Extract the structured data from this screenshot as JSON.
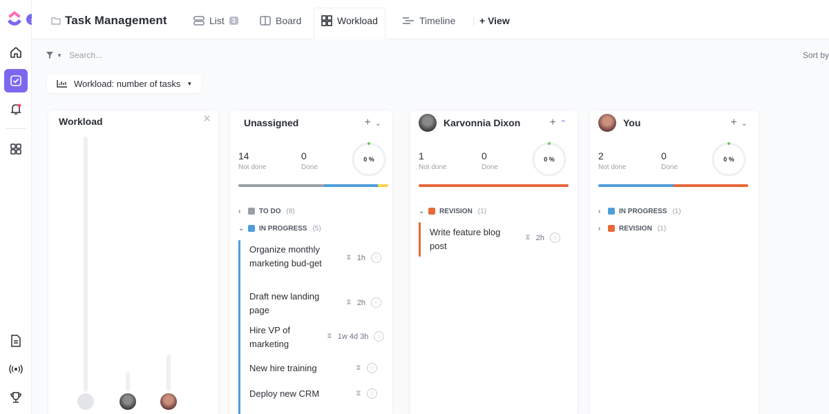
{
  "app": {
    "project_title": "Task Management",
    "views": [
      {
        "label": "List",
        "badge": "3"
      },
      {
        "label": "Board"
      },
      {
        "label": "Workload"
      },
      {
        "label": "Timeline"
      }
    ],
    "add_view_label": "+ View",
    "active_view": "Workload"
  },
  "toolbar": {
    "search_placeholder": "Search...",
    "sort_label": "Sort by",
    "workload_select": "Workload: number of tasks"
  },
  "workload_panel": {
    "title": "Workload"
  },
  "columns": [
    {
      "name": "Unassigned",
      "not_done": "14",
      "done": "0",
      "not_done_label": "Not done",
      "done_label": "Done",
      "percent": "0 %",
      "groups": [
        {
          "status": "TO DO",
          "count": "(8)",
          "color": "#9aa0a8",
          "expanded": false
        },
        {
          "status": "IN PROGRESS",
          "count": "(5)",
          "color": "#4f9ed9",
          "expanded": true
        }
      ],
      "tasks": [
        {
          "name": "Organize monthly marketing bud-get",
          "estimate": "1h"
        },
        {
          "name": "Draft new landing page",
          "estimate": "2h"
        },
        {
          "name": "Hire VP of marketing",
          "estimate": "1w 4d 3h"
        },
        {
          "name": "New hire training",
          "estimate": ""
        },
        {
          "name": "Deploy new CRM",
          "estimate": ""
        }
      ]
    },
    {
      "name": "Karvonnia Dixon",
      "not_done": "1",
      "done": "0",
      "not_done_label": "Not done",
      "done_label": "Done",
      "percent": "0 %",
      "groups": [
        {
          "status": "REVISION",
          "count": "(1)",
          "color": "#e8693b",
          "expanded": true
        }
      ],
      "tasks": [
        {
          "name": "Write feature blog post",
          "estimate": "2h"
        }
      ]
    },
    {
      "name": "You",
      "not_done": "2",
      "done": "0",
      "not_done_label": "Not done",
      "done_label": "Done",
      "percent": "0 %",
      "groups": [
        {
          "status": "IN PROGRESS",
          "count": "(1)",
          "color": "#4f9ed9",
          "expanded": false
        },
        {
          "status": "REVISION",
          "count": "(1)",
          "color": "#e8693b",
          "expanded": false
        }
      ],
      "tasks": []
    }
  ],
  "colors": {
    "accent": "#7b68ee",
    "in_progress": "#4f9ed9",
    "revision": "#e8693b",
    "todo": "#9aa0a8",
    "done_ring": "#6bc950",
    "yellow": "#f7d44c"
  },
  "icons": [
    "home-icon",
    "task-icon",
    "bell-icon",
    "grid-icon",
    "doc-icon",
    "broadcast-icon",
    "trophy-icon",
    "folder-icon",
    "list-icon",
    "board-icon",
    "workload-icon",
    "timeline-icon",
    "filter-icon",
    "chart-icon",
    "plus-icon",
    "collapse-icon",
    "expand-icon",
    "hourglass-icon",
    "star-icon",
    "close-icon"
  ]
}
